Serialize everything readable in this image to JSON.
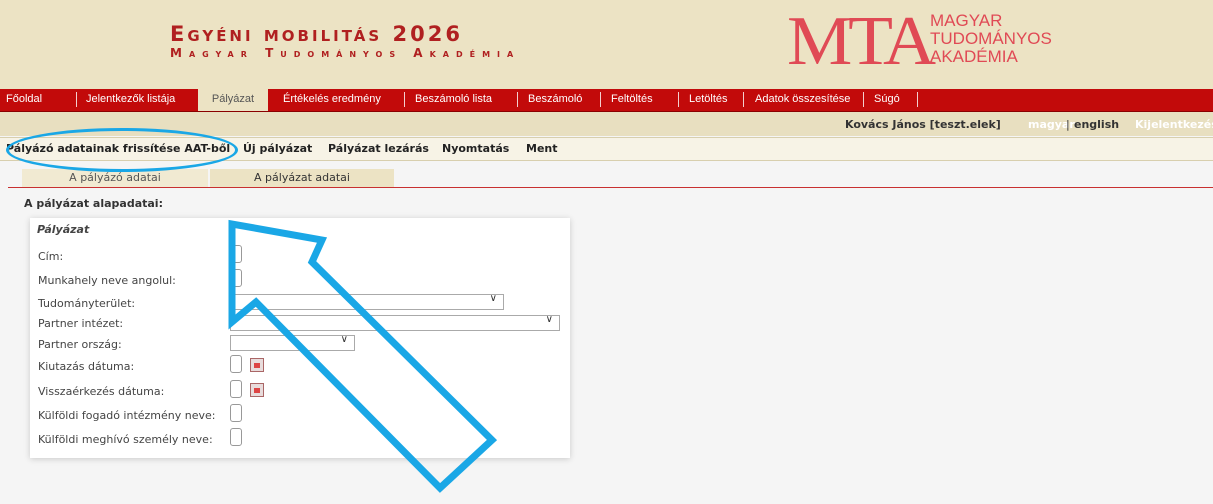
{
  "header": {
    "app_title": "Egyéni mobilitás 2026",
    "app_subtitle": "Magyar Tudományos Akadémia",
    "logo_mark": "MTA",
    "logo_lines": [
      "MAGYAR",
      "TUDOMÁNYOS",
      "AKADÉMIA"
    ]
  },
  "nav": {
    "items": [
      {
        "label": "Főoldal"
      },
      {
        "label": "Jelentkezők listája"
      },
      {
        "label": "Pályázat"
      },
      {
        "label": "Értékelés eredmény"
      },
      {
        "label": "Beszámoló lista"
      },
      {
        "label": "Beszámoló"
      },
      {
        "label": "Feltöltés"
      },
      {
        "label": "Letöltés"
      },
      {
        "label": "Adatok összesítése"
      },
      {
        "label": "Súgó"
      }
    ],
    "active": "Pályázat"
  },
  "userbar": {
    "user": "Kovács János [teszt.elek]",
    "lang_magyar": "magyar",
    "separator": "|",
    "lang_english": "english",
    "logout": "Kijelentkezés"
  },
  "toolbar": {
    "refresh": "Pályázó adatainak frissítése AAT-ből",
    "new": "Új pályázat",
    "close": "Pályázat lezárás",
    "print": "Nyomtatás",
    "save": "Ment"
  },
  "tabs": {
    "applicant": "A pályázó adatai",
    "application": "A pályázat adatai"
  },
  "section_title": "A pályázat alapadatai:",
  "form": {
    "legend": "Pályázat",
    "fields": {
      "title": "Cím:",
      "workplace_en": "Munkahely neve angolul:",
      "field": "Tudományterület:",
      "partner_institute": "Partner intézet:",
      "partner_country": "Partner ország:",
      "departure": "Kiutazás dátuma:",
      "return": "Visszaérkezés dátuma:",
      "host_institution": "Külföldi fogadó intézmény neve:",
      "inviting_person": "Külföldi meghívó személy neve:"
    }
  },
  "colors": {
    "brand_red": "#c20a0a",
    "header_beige": "#ece3c4",
    "highlight_blue": "#1aa7e6",
    "logo_red": "#e04a55"
  }
}
